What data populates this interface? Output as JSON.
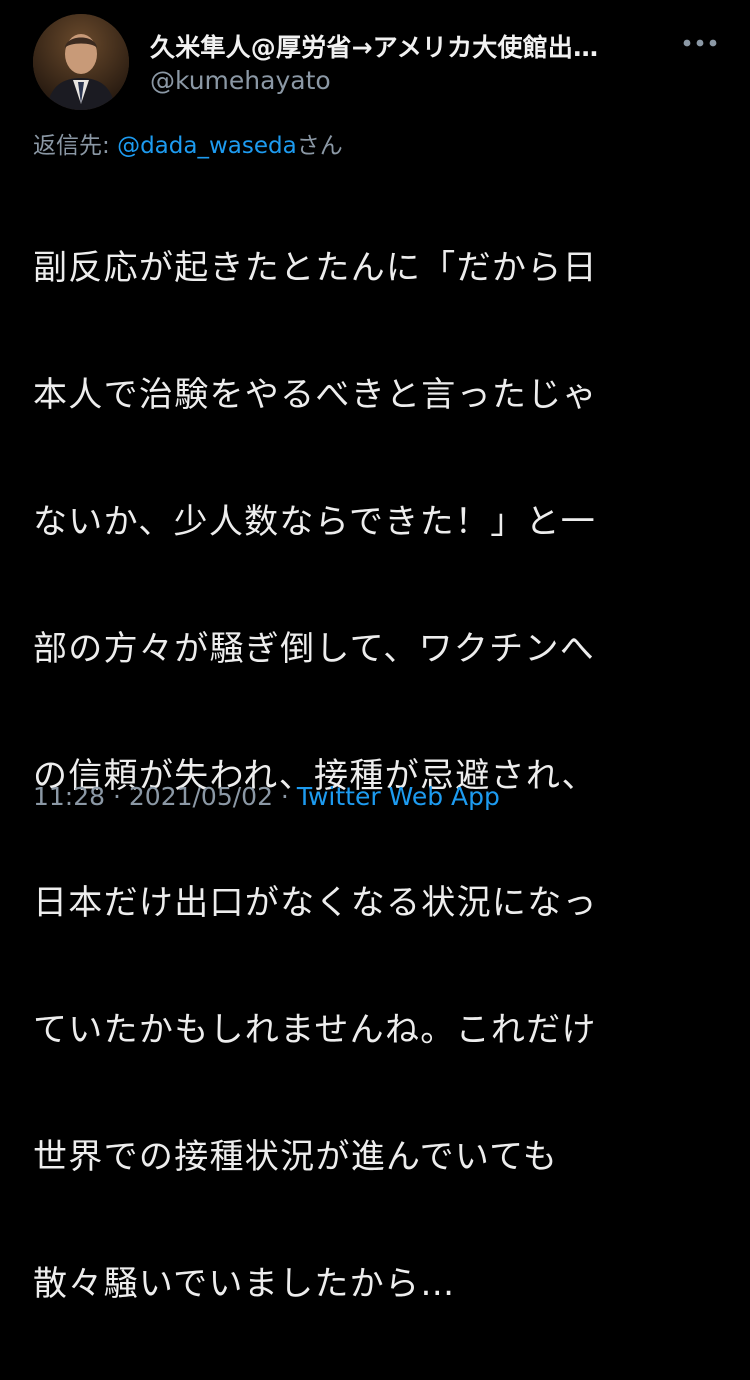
{
  "author": {
    "display_name": "久米隼人@厚労省→アメリカ大使館出…",
    "handle": "@kumehayato",
    "avatar_icon": "profile-photo"
  },
  "more_icon": "more-horizontal-icon",
  "reply": {
    "prefix": "返信先: ",
    "mention": "@dada_waseda",
    "suffix": "さん"
  },
  "tweet": {
    "lines": [
      "副反応が起きたとたんに「だから日",
      "本人で治験をやるべきと言ったじゃ",
      "ないか、少人数ならできた！」と一",
      "部の方々が騒ぎ倒して、ワクチンへ",
      "の信頼が失われ、接種が忌避され、",
      "日本だけ出口がなくなる状況になっ",
      "ていたかもしれませんね。これだけ",
      "世界での接種状況が進んでいても",
      "散々騒いでいましたから…"
    ]
  },
  "meta": {
    "time": "11:28",
    "separator": " · ",
    "date": "2021/05/02",
    "separator2": " · ",
    "source": "Twitter Web App"
  },
  "colors": {
    "background": "#000000",
    "link": "#1d9bf0",
    "secondary": "#8b98a5",
    "text": "#ededed"
  }
}
